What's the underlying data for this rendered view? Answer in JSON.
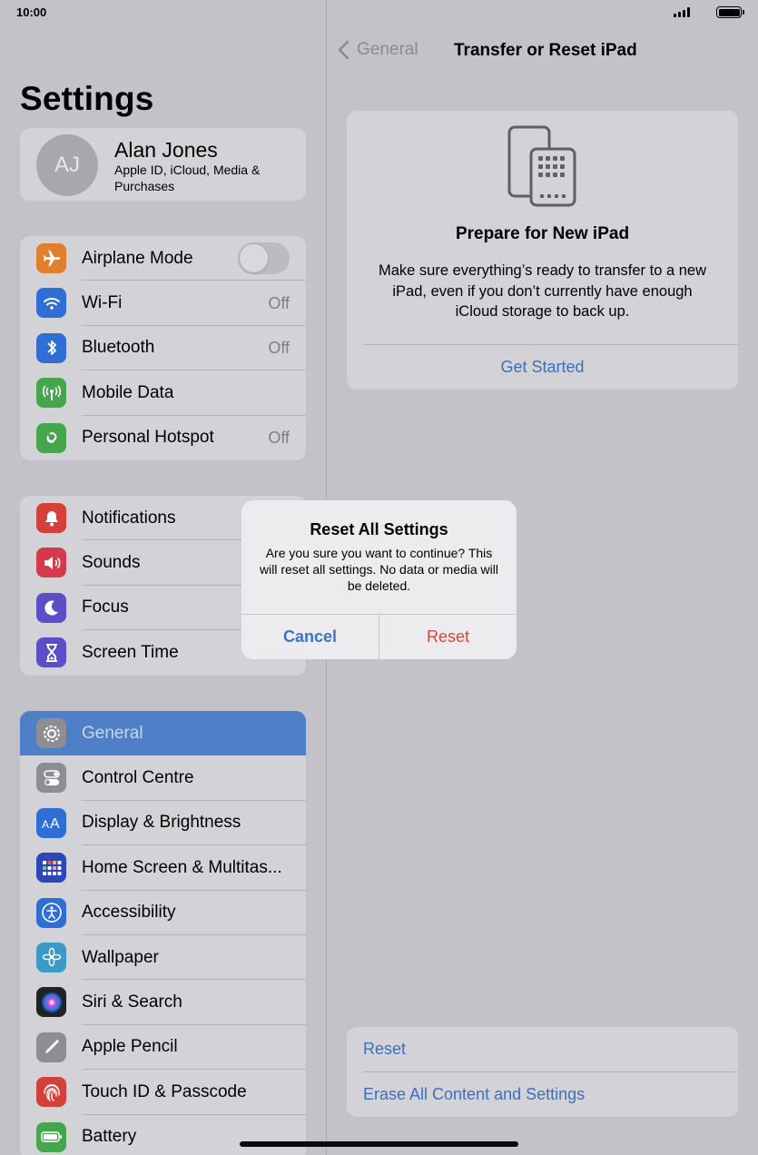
{
  "status": {
    "time": "10:00"
  },
  "sidebar": {
    "title": "Settings",
    "profile": {
      "initials": "AJ",
      "name": "Alan Jones",
      "subtitle": "Apple ID, iCloud, Media & Purchases"
    },
    "group1": [
      {
        "label": "Airplane Mode",
        "icon": "airplane-icon",
        "color": "#e07f2c",
        "toggle": "off"
      },
      {
        "label": "Wi-Fi",
        "icon": "wifi-icon",
        "color": "#2f6fd5",
        "value": "Off"
      },
      {
        "label": "Bluetooth",
        "icon": "bluetooth-icon",
        "color": "#2f6fd5",
        "value": "Off"
      },
      {
        "label": "Mobile Data",
        "icon": "antenna-icon",
        "color": "#45a64e"
      },
      {
        "label": "Personal Hotspot",
        "icon": "hotspot-icon",
        "color": "#45a64e",
        "value": "Off"
      }
    ],
    "group2": [
      {
        "label": "Notifications",
        "icon": "bell-icon",
        "color": "#d6403a"
      },
      {
        "label": "Sounds",
        "icon": "speaker-icon",
        "color": "#d43a4e"
      },
      {
        "label": "Focus",
        "icon": "moon-icon",
        "color": "#5a4fc7"
      },
      {
        "label": "Screen Time",
        "icon": "hourglass-icon",
        "color": "#5a4fc7"
      }
    ],
    "group3": [
      {
        "label": "General",
        "icon": "gear-icon",
        "color": "#8e8d93",
        "active": true
      },
      {
        "label": "Control Centre",
        "icon": "switches-icon",
        "color": "#8e8d93"
      },
      {
        "label": "Display & Brightness",
        "icon": "text-size-icon",
        "color": "#2f6fd5"
      },
      {
        "label": "Home Screen & Multitas...",
        "icon": "grid-icon",
        "color": "#2c47b8"
      },
      {
        "label": "Accessibility",
        "icon": "accessibility-icon",
        "color": "#2f6fd5"
      },
      {
        "label": "Wallpaper",
        "icon": "flower-icon",
        "color": "#3c9bc6"
      },
      {
        "label": "Siri & Search",
        "icon": "siri-icon",
        "color": "#222222"
      },
      {
        "label": "Apple Pencil",
        "icon": "pencil-icon",
        "color": "#8e8d93"
      },
      {
        "label": "Touch ID & Passcode",
        "icon": "fingerprint-icon",
        "color": "#d6403a"
      },
      {
        "label": "Battery",
        "icon": "battery-icon",
        "color": "#45a64e"
      }
    ]
  },
  "detail": {
    "back_label": "General",
    "title": "Transfer or Reset iPad",
    "prepare": {
      "title": "Prepare for New iPad",
      "description": "Make sure everything’s ready to transfer to a new iPad, even if you don’t currently have enough iCloud storage to back up.",
      "link": "Get Started"
    },
    "bottom_items": [
      "Reset",
      "Erase All Content and Settings"
    ]
  },
  "alert": {
    "title": "Reset All Settings",
    "message": "Are you sure you want to continue? This will reset all settings. No data or media will be deleted.",
    "cancel_label": "Cancel",
    "confirm_label": "Reset"
  },
  "colors": {
    "accent": "#3d6fbf",
    "destructive": "#d9463e",
    "selection": "#4f7fc6"
  }
}
